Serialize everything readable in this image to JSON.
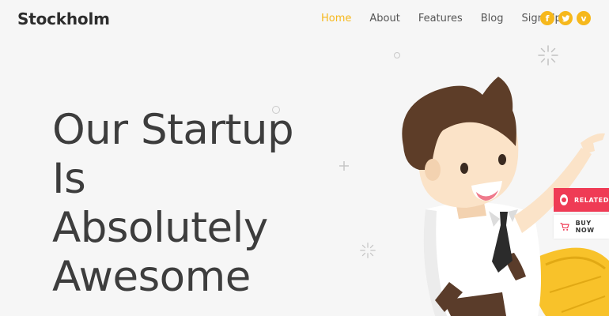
{
  "brand": {
    "name": "Stockholm"
  },
  "nav": {
    "items": [
      {
        "label": "Home",
        "active": true
      },
      {
        "label": "About",
        "active": false
      },
      {
        "label": "Features",
        "active": false
      },
      {
        "label": "Blog",
        "active": false
      },
      {
        "label": "Sign Up",
        "active": false
      }
    ]
  },
  "social": [
    {
      "icon": "facebook-icon",
      "glyph": "f"
    },
    {
      "icon": "twitter-icon",
      "glyph": "t"
    },
    {
      "icon": "vimeo-icon",
      "glyph": "v"
    }
  ],
  "hero": {
    "lines": [
      "Our Startup",
      "Is",
      "Absolutely",
      "Awesome"
    ]
  },
  "side_widgets": {
    "related_label": "RELATED",
    "buy_label": "BUY NOW"
  },
  "colors": {
    "accent": "#f6b81c",
    "related": "#ef3b55",
    "background": "#f6f6f6",
    "text": "#3d3d3d"
  }
}
